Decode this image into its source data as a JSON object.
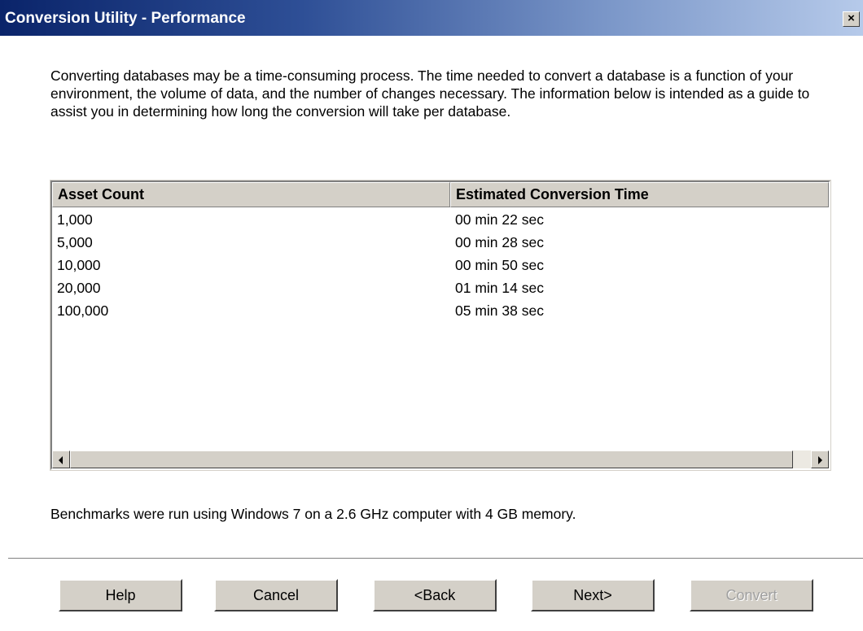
{
  "window": {
    "title": "Conversion Utility - Performance",
    "close_glyph": "×"
  },
  "intro_text": "Converting databases may be a time-consuming process. The time needed to convert a database is a function of your environment, the volume of data, and the number of changes necessary. The information below is intended as a guide to assist you in determining how long the conversion will take per database.",
  "table": {
    "columns": [
      "Asset Count",
      "Estimated Conversion Time"
    ],
    "rows": [
      [
        "1,000",
        "00 min 22 sec"
      ],
      [
        "5,000",
        "00 min 28 sec"
      ],
      [
        "10,000",
        "00 min 50 sec"
      ],
      [
        "20,000",
        "01 min 14 sec"
      ],
      [
        "100,000",
        "05 min 38 sec"
      ]
    ]
  },
  "benchmark_text": "Benchmarks were run using Windows 7 on a 2.6 GHz computer with 4 GB memory.",
  "buttons": {
    "help": "Help",
    "cancel": "Cancel",
    "back": "<Back",
    "next": "Next>",
    "convert": "Convert"
  },
  "icons": {
    "close": "close-icon",
    "scroll_left": "scroll-left-arrow-icon",
    "scroll_right": "scroll-right-arrow-icon"
  },
  "colors": {
    "titlebar_start": "#0a246a",
    "titlebar_end": "#b6caea",
    "face": "#d4d0c8",
    "disabled_text": "#a0a0a0"
  }
}
